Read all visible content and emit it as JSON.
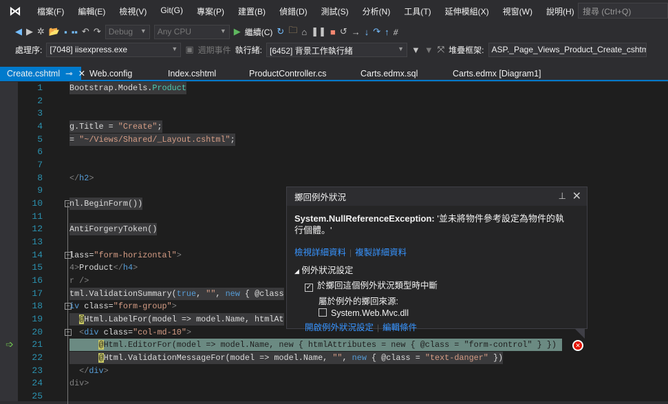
{
  "menu": {
    "items": [
      "檔案(F)",
      "編輯(E)",
      "檢視(V)",
      "Git(G)",
      "專案(P)",
      "建置(B)",
      "偵錯(D)",
      "測試(S)",
      "分析(N)",
      "工具(T)",
      "延伸模組(X)",
      "視窗(W)",
      "說明(H)"
    ],
    "search_placeholder": "搜尋 (Ctrl+Q)"
  },
  "toolbar": {
    "config": "Debug",
    "platform": "Any CPU",
    "continue_label": "繼續(C)"
  },
  "debugbar": {
    "process_label": "處理序:",
    "process_value": "[7048] iisexpress.exe",
    "lifecycle_label": "週期事件",
    "thread_label": "執行緒:",
    "thread_value": "[6452] 背景工作執行緒",
    "stack_label": "堆疊框架:",
    "stack_value": "ASP._Page_Views_Product_Create_cshtml"
  },
  "tabs": [
    {
      "label": "Create.cshtml",
      "active": true
    },
    {
      "label": "Web.config"
    },
    {
      "label": "Index.cshtml"
    },
    {
      "label": "ProductController.cs"
    },
    {
      "label": "Carts.edmx.sql"
    },
    {
      "label": "Carts.edmx [Diagram1]"
    }
  ],
  "code": {
    "lines": [
      [
        [
          "Bootstrap.Models.",
          ""
        ],
        [
          "Product",
          "t-type"
        ]
      ],
      [],
      [],
      [
        [
          "g.Title = ",
          ""
        ],
        [
          "\"Create\"",
          "t-str"
        ],
        [
          ";",
          ""
        ]
      ],
      [
        [
          "= ",
          ""
        ],
        [
          "\"~/Views/Shared/_Layout.cshtml\"",
          "t-str"
        ],
        [
          ";",
          ""
        ]
      ],
      [],
      [],
      [
        [
          "</",
          "t-tag"
        ],
        [
          "h2",
          "t-tn"
        ],
        [
          ">",
          "t-tag"
        ]
      ],
      [],
      [
        [
          "nl.BeginForm())",
          ""
        ]
      ],
      [],
      [
        [
          "AntiForgeryToken()",
          ""
        ]
      ],
      [],
      [
        [
          "lass=",
          ""
        ],
        [
          "\"form-horizontal\"",
          "t-str"
        ],
        [
          ">",
          "t-tag"
        ]
      ],
      [
        [
          "4>",
          "t-tag"
        ],
        [
          "Product",
          ""
        ],
        [
          "</",
          "t-tag"
        ],
        [
          "h4",
          "t-tn"
        ],
        [
          ">",
          "t-tag"
        ]
      ],
      [
        [
          "r />",
          "t-tag"
        ]
      ],
      [
        [
          "tml.ValidationSummary(",
          ""
        ],
        [
          "true",
          "t-kw"
        ],
        [
          ", ",
          ""
        ],
        [
          "\"\"",
          "t-str"
        ],
        [
          ", ",
          ""
        ],
        [
          "new",
          "t-kw"
        ],
        [
          " { @class",
          ""
        ]
      ],
      [
        [
          "iv ",
          "t-tn"
        ],
        [
          "class=",
          ""
        ],
        [
          "\"form-group\"",
          "t-str"
        ],
        [
          ">",
          "t-tag"
        ]
      ],
      [
        [
          "  ",
          ""
        ],
        [
          "@",
          "t-raz"
        ],
        [
          "Html.LabelFor(model => model.Name, htmlAt",
          ""
        ]
      ],
      [
        [
          "  ",
          ""
        ],
        [
          "<",
          "t-tag"
        ],
        [
          "div ",
          "t-tn"
        ],
        [
          "class=",
          ""
        ],
        [
          "\"col-md-10\"",
          "t-str"
        ],
        [
          ">",
          "t-tag"
        ]
      ],
      [
        [
          "      ",
          ""
        ],
        [
          "@",
          "t-raz"
        ],
        [
          "Html.EditorFor(model => model.Name, new { htmlAttributes = new { @class = \"form-control\" } })",
          ""
        ]
      ],
      [
        [
          "      ",
          ""
        ],
        [
          "@",
          "t-raz"
        ],
        [
          "Html.ValidationMessageFor(model => model.Name, ",
          ""
        ],
        [
          "\"\"",
          "t-str"
        ],
        [
          ", ",
          ""
        ],
        [
          "new",
          "t-kw"
        ],
        [
          " { @class = ",
          ""
        ],
        [
          "\"text-danger\"",
          "t-str"
        ],
        [
          " })",
          ""
        ]
      ],
      [
        [
          "  ",
          ""
        ],
        [
          "</",
          "t-tag"
        ],
        [
          "div",
          "t-tn"
        ],
        [
          ">",
          "t-tag"
        ]
      ],
      [
        [
          "div>",
          "t-tag"
        ]
      ],
      []
    ]
  },
  "exception": {
    "title": "擲回例外狀況",
    "type": "System.NullReferenceException:",
    "message_line1": " '並未將物件參考設定為物件的執",
    "message_line2": "行個體。'",
    "view_details": "檢視詳細資料",
    "copy_details": "複製詳細資料",
    "settings_header": "例外狀況設定",
    "break_label": "於擲回這個例外狀況類型時中斷",
    "break_checked": true,
    "source_label": "屬於例外的擲回來源:",
    "source_item": "System.Web.Mvc.dll",
    "source_checked": false,
    "open_settings": "開啟例外狀況設定",
    "edit_conditions": "編輯條件"
  },
  "colors": {
    "accent": "#007acc",
    "error": "#e51400"
  }
}
